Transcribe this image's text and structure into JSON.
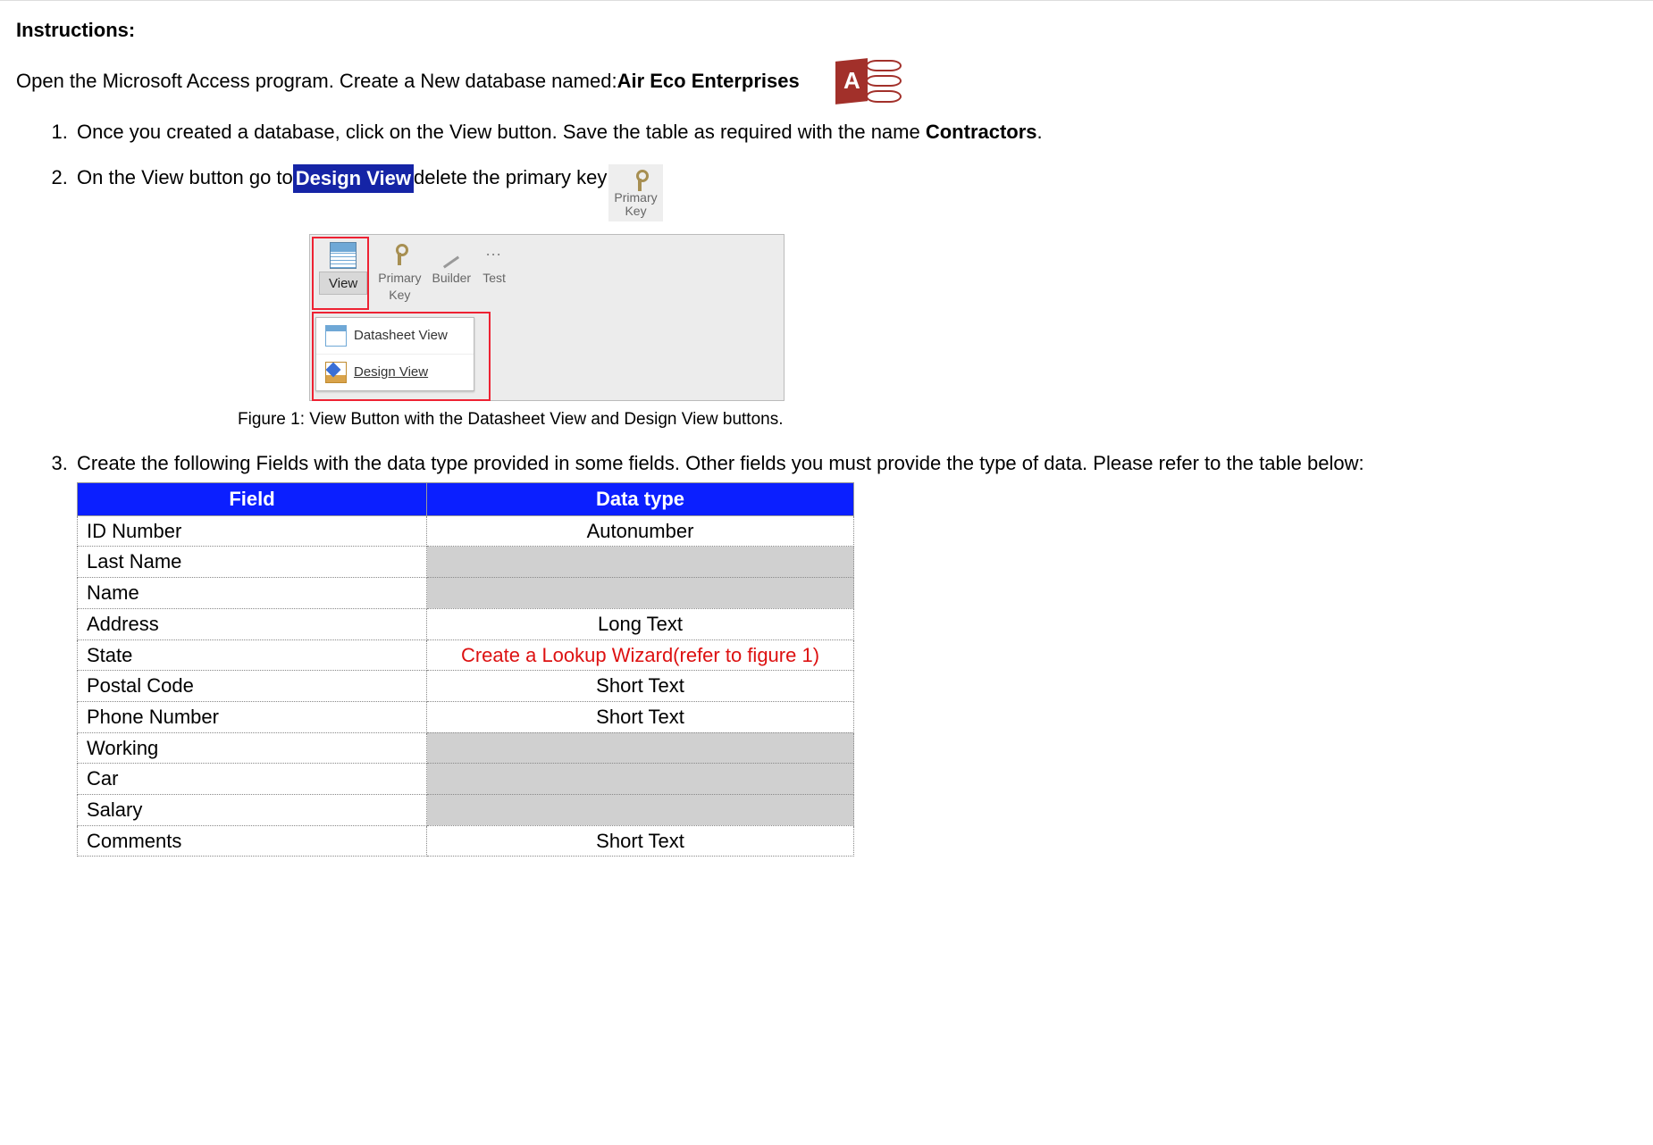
{
  "heading": "Instructions:",
  "intro_prefix": "Open the Microsoft Access program.  Create a New database named:  ",
  "intro_dbname": "Air Eco Enterprises",
  "step1": {
    "prefix": "Once you created a database, click on the View button.  Save the table as required with the name ",
    "bold": "Contractors",
    "suffix": "."
  },
  "step2": {
    "pre": "On the View button go to ",
    "highlight": "Design View",
    "post": " delete the primary key",
    "pk_label_line1": "Primary",
    "pk_label_line2": "Key"
  },
  "ribbon": {
    "view": "View",
    "primary": "Primary",
    "key": "Key",
    "builder": "Builder",
    "test": "Test"
  },
  "menu": {
    "datasheet": "Datasheet View",
    "design": "Design View"
  },
  "caption": "Figure 1:  View Button with the Datasheet View and Design View buttons.",
  "step3_intro": "Create the following Fields with the data type provided in some fields.  Other fields you must provide the type of data.  Please refer to the table below:",
  "table": {
    "h1": "Field",
    "h2": "Data type",
    "rows": [
      {
        "field": "ID Number",
        "type": "Autonumber",
        "gray": false
      },
      {
        "field": "Last Name",
        "type": "",
        "gray": true
      },
      {
        "field": "Name",
        "type": "",
        "gray": true
      },
      {
        "field": "Address",
        "type": "Long Text",
        "gray": false
      },
      {
        "field": "State",
        "type": "Create a Lookup Wizard(refer to figure 1)",
        "gray": false,
        "red": true
      },
      {
        "field": "Postal Code",
        "type": "Short Text",
        "gray": false
      },
      {
        "field": "Phone Number",
        "type": "Short Text",
        "gray": false
      },
      {
        "field": "Working",
        "type": "",
        "gray": true
      },
      {
        "field": "Car",
        "type": "",
        "gray": true
      },
      {
        "field": "Salary",
        "type": "",
        "gray": true
      },
      {
        "field": "Comments",
        "type": "Short Text",
        "gray": false
      }
    ]
  }
}
